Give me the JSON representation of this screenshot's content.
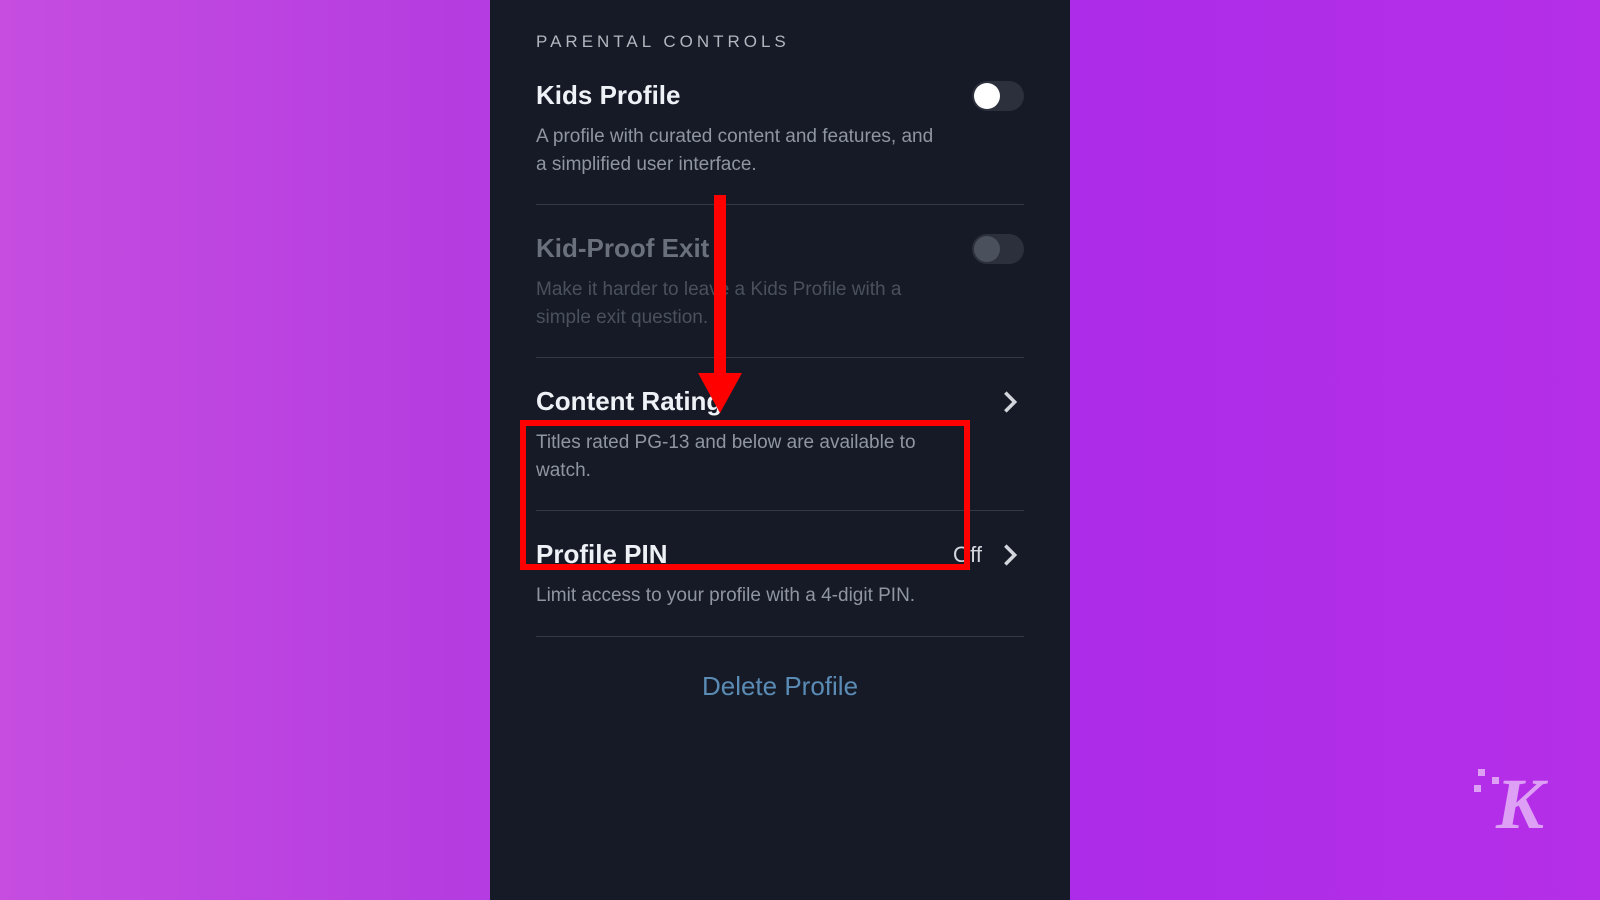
{
  "section_header": "PARENTAL CONTROLS",
  "rows": {
    "kids_profile": {
      "title": "Kids Profile",
      "desc": "A profile with curated content and features, and a simplified user interface."
    },
    "kid_proof_exit": {
      "title": "Kid-Proof Exit",
      "desc": "Make it harder to leave a Kids Profile with a simple exit question."
    },
    "content_rating": {
      "title": "Content Rating",
      "desc": "Titles rated PG-13 and below are available to watch."
    },
    "profile_pin": {
      "title": "Profile PIN",
      "desc": "Limit access to your profile with a 4-digit PIN.",
      "status": "Off"
    }
  },
  "delete_label": "Delete Profile",
  "annotation": {
    "highlight_target": "content_rating"
  },
  "watermark": "K"
}
